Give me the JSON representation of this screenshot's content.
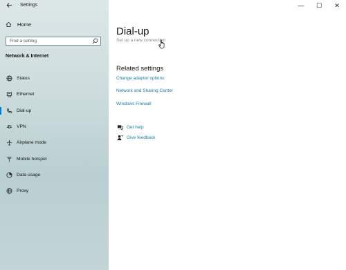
{
  "window": {
    "title": "Settings",
    "controls": {
      "minimize": "—",
      "maximize": "☐",
      "close": "✕"
    }
  },
  "sidebar": {
    "back_icon": "arrow-left-icon",
    "home_label": "Home",
    "search_placeholder": "Find a setting",
    "section_title": "Network & Internet",
    "items": [
      {
        "label": "Status",
        "icon": "globe-status-icon",
        "active": false
      },
      {
        "label": "Ethernet",
        "icon": "ethernet-icon",
        "active": false
      },
      {
        "label": "Dial-up",
        "icon": "dialup-icon",
        "active": true
      },
      {
        "label": "VPN",
        "icon": "vpn-icon",
        "active": false
      },
      {
        "label": "Airplane mode",
        "icon": "airplane-icon",
        "active": false
      },
      {
        "label": "Mobile hotspot",
        "icon": "hotspot-icon",
        "active": false
      },
      {
        "label": "Data usage",
        "icon": "data-usage-icon",
        "active": false
      },
      {
        "label": "Proxy",
        "icon": "globe-icon",
        "active": false
      }
    ]
  },
  "main": {
    "page_title": "Dial-up",
    "setup_link": "Set up a new connection",
    "related_title": "Related settings",
    "related_links": [
      "Change adapter options",
      "Network and Sharing Center",
      "Windows Firewall"
    ],
    "help": {
      "get_help": "Get help",
      "give_feedback": "Give feedback"
    }
  },
  "colors": {
    "accent": "#0078d7",
    "link": "#0f7fae",
    "disabled_text": "#888888"
  }
}
